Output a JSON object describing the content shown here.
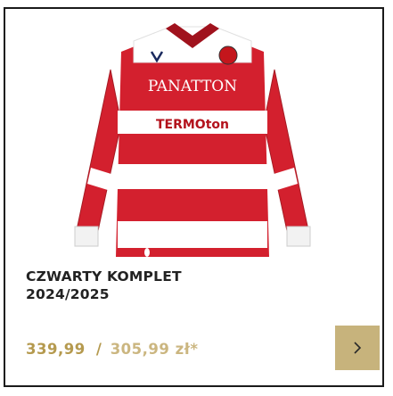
{
  "product": {
    "title_line1": "CZWARTY KOMPLET",
    "title_line2": "2024/2025",
    "price": "339,99",
    "price_separator": "/",
    "price_secondary": "305,99 zł*",
    "image_texts": {
      "brand": "PANATTON",
      "sponsor": "TERMOton"
    }
  },
  "colors": {
    "accent": "#c7b37c",
    "price": "#b59a4f",
    "shirt_red": "#d3202e",
    "shirt_white": "#ffffff"
  },
  "icons": {
    "next": "chevron-right-icon"
  }
}
